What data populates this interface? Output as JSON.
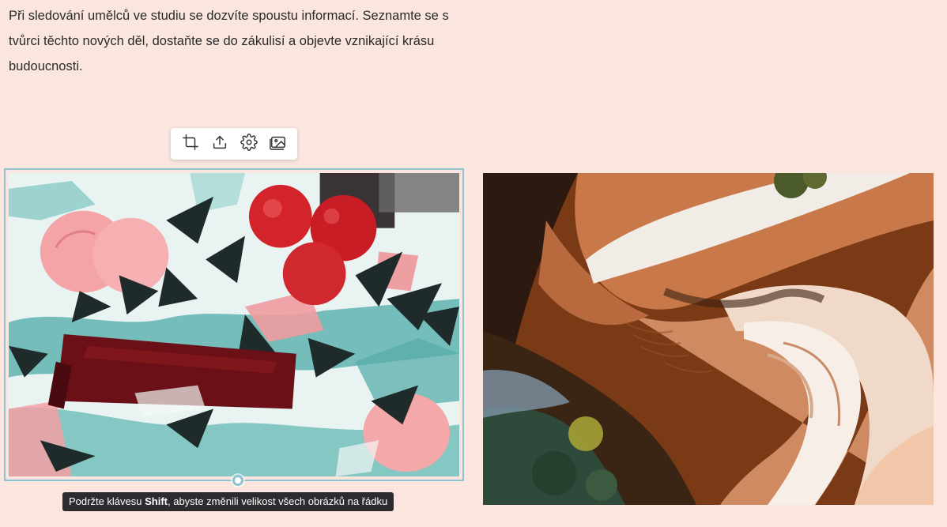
{
  "intro": {
    "text": "Při sledování umělců ve studiu se dozvíte spoustu informací. Seznamte se s tvůrci těchto nových děl, dostaňte se do zákulisí a objevte vznikající krásu budoucnosti."
  },
  "toolbar": {
    "buttons": [
      {
        "name": "crop",
        "icon": "crop-icon"
      },
      {
        "name": "upload",
        "icon": "upload-icon"
      },
      {
        "name": "settings",
        "icon": "gear-icon"
      },
      {
        "name": "replace-image",
        "icon": "images-icon"
      }
    ]
  },
  "images": {
    "left": {
      "subject": "abstract painting with pink fruit, red berries, teal leaves and dark red bowl"
    },
    "right": {
      "subject": "aerial view of orange sand and river"
    }
  },
  "tooltip": {
    "prefix": "Podržte klávesu ",
    "key": "Shift",
    "suffix": ", abyste změnili velikost všech obrázků na řádku"
  },
  "colors": {
    "background": "#fae6df",
    "selection": "#8fc3cf",
    "tooltip_bg": "#2b2b30"
  }
}
